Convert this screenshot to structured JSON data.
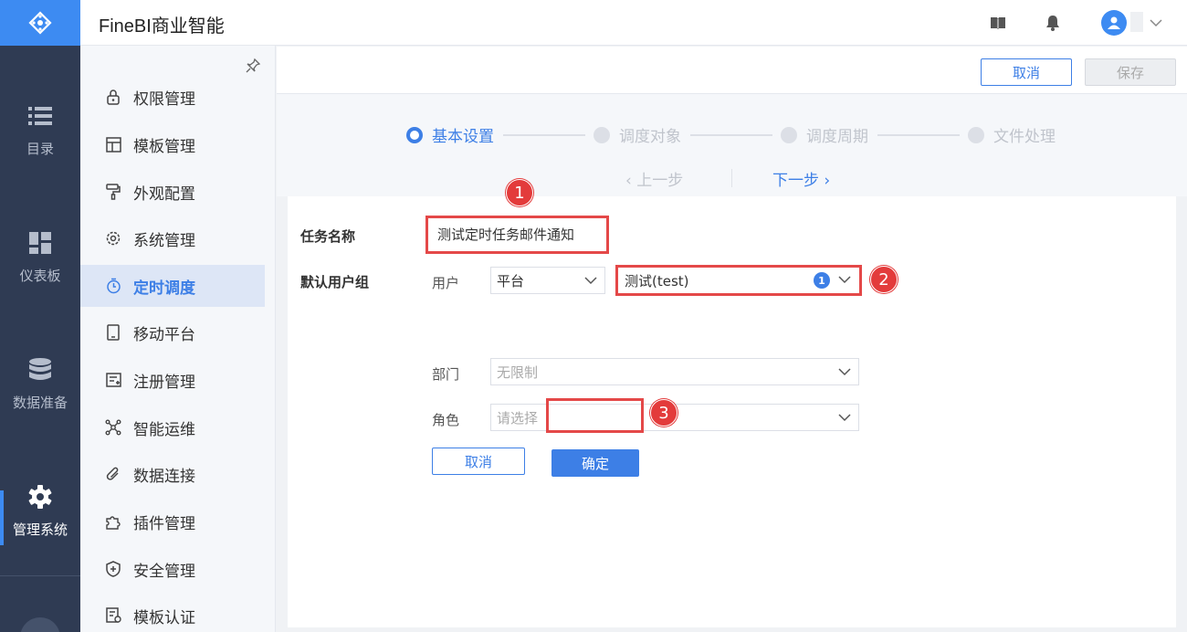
{
  "app": {
    "title": "FineBI商业智能"
  },
  "rail": {
    "items": [
      {
        "label": "目录",
        "icon": "list-icon"
      },
      {
        "label": "仪表板",
        "icon": "dashboard-grid-icon"
      },
      {
        "label": "数据准备",
        "icon": "database-icon"
      },
      {
        "label": "管理系统",
        "icon": "gear-icon",
        "active": true
      }
    ]
  },
  "sidebar": {
    "items": [
      {
        "label": "权限管理",
        "icon": "lock-icon"
      },
      {
        "label": "模板管理",
        "icon": "template-icon"
      },
      {
        "label": "外观配置",
        "icon": "paint-roller-icon"
      },
      {
        "label": "系统管理",
        "icon": "gear-icon"
      },
      {
        "label": "定时调度",
        "icon": "timer-icon",
        "active": true
      },
      {
        "label": "移动平台",
        "icon": "mobile-icon"
      },
      {
        "label": "注册管理",
        "icon": "register-icon"
      },
      {
        "label": "智能运维",
        "icon": "network-icon"
      },
      {
        "label": "数据连接",
        "icon": "paperclip-icon"
      },
      {
        "label": "插件管理",
        "icon": "puzzle-icon"
      },
      {
        "label": "安全管理",
        "icon": "shield-icon"
      },
      {
        "label": "模板认证",
        "icon": "certificate-icon"
      }
    ]
  },
  "toolbar": {
    "cancel_label": "取消",
    "save_label": "保存"
  },
  "steps": {
    "items": [
      {
        "label": "基本设置",
        "active": true
      },
      {
        "label": "调度对象",
        "active": false
      },
      {
        "label": "调度周期",
        "active": false
      },
      {
        "label": "文件处理",
        "active": false
      }
    ],
    "prev_label": "上一步",
    "next_label": "下一步"
  },
  "form": {
    "task_name_label": "任务名称",
    "task_name_value": "测试定时任务邮件通知",
    "user_group_label": "默认用户组",
    "user_label": "用户",
    "user_source_value": "平台",
    "user_value": "测试(test)",
    "user_count": "1",
    "dept_label": "部门",
    "dept_value": "无限制",
    "role_label": "角色",
    "role_placeholder": "请选择",
    "cancel_label": "取消",
    "confirm_label": "确定"
  },
  "callouts": [
    "1",
    "2",
    "3"
  ],
  "colors": {
    "accent": "#3d7fe6",
    "rail": "#2f3b53",
    "highlight": "#e44848"
  }
}
